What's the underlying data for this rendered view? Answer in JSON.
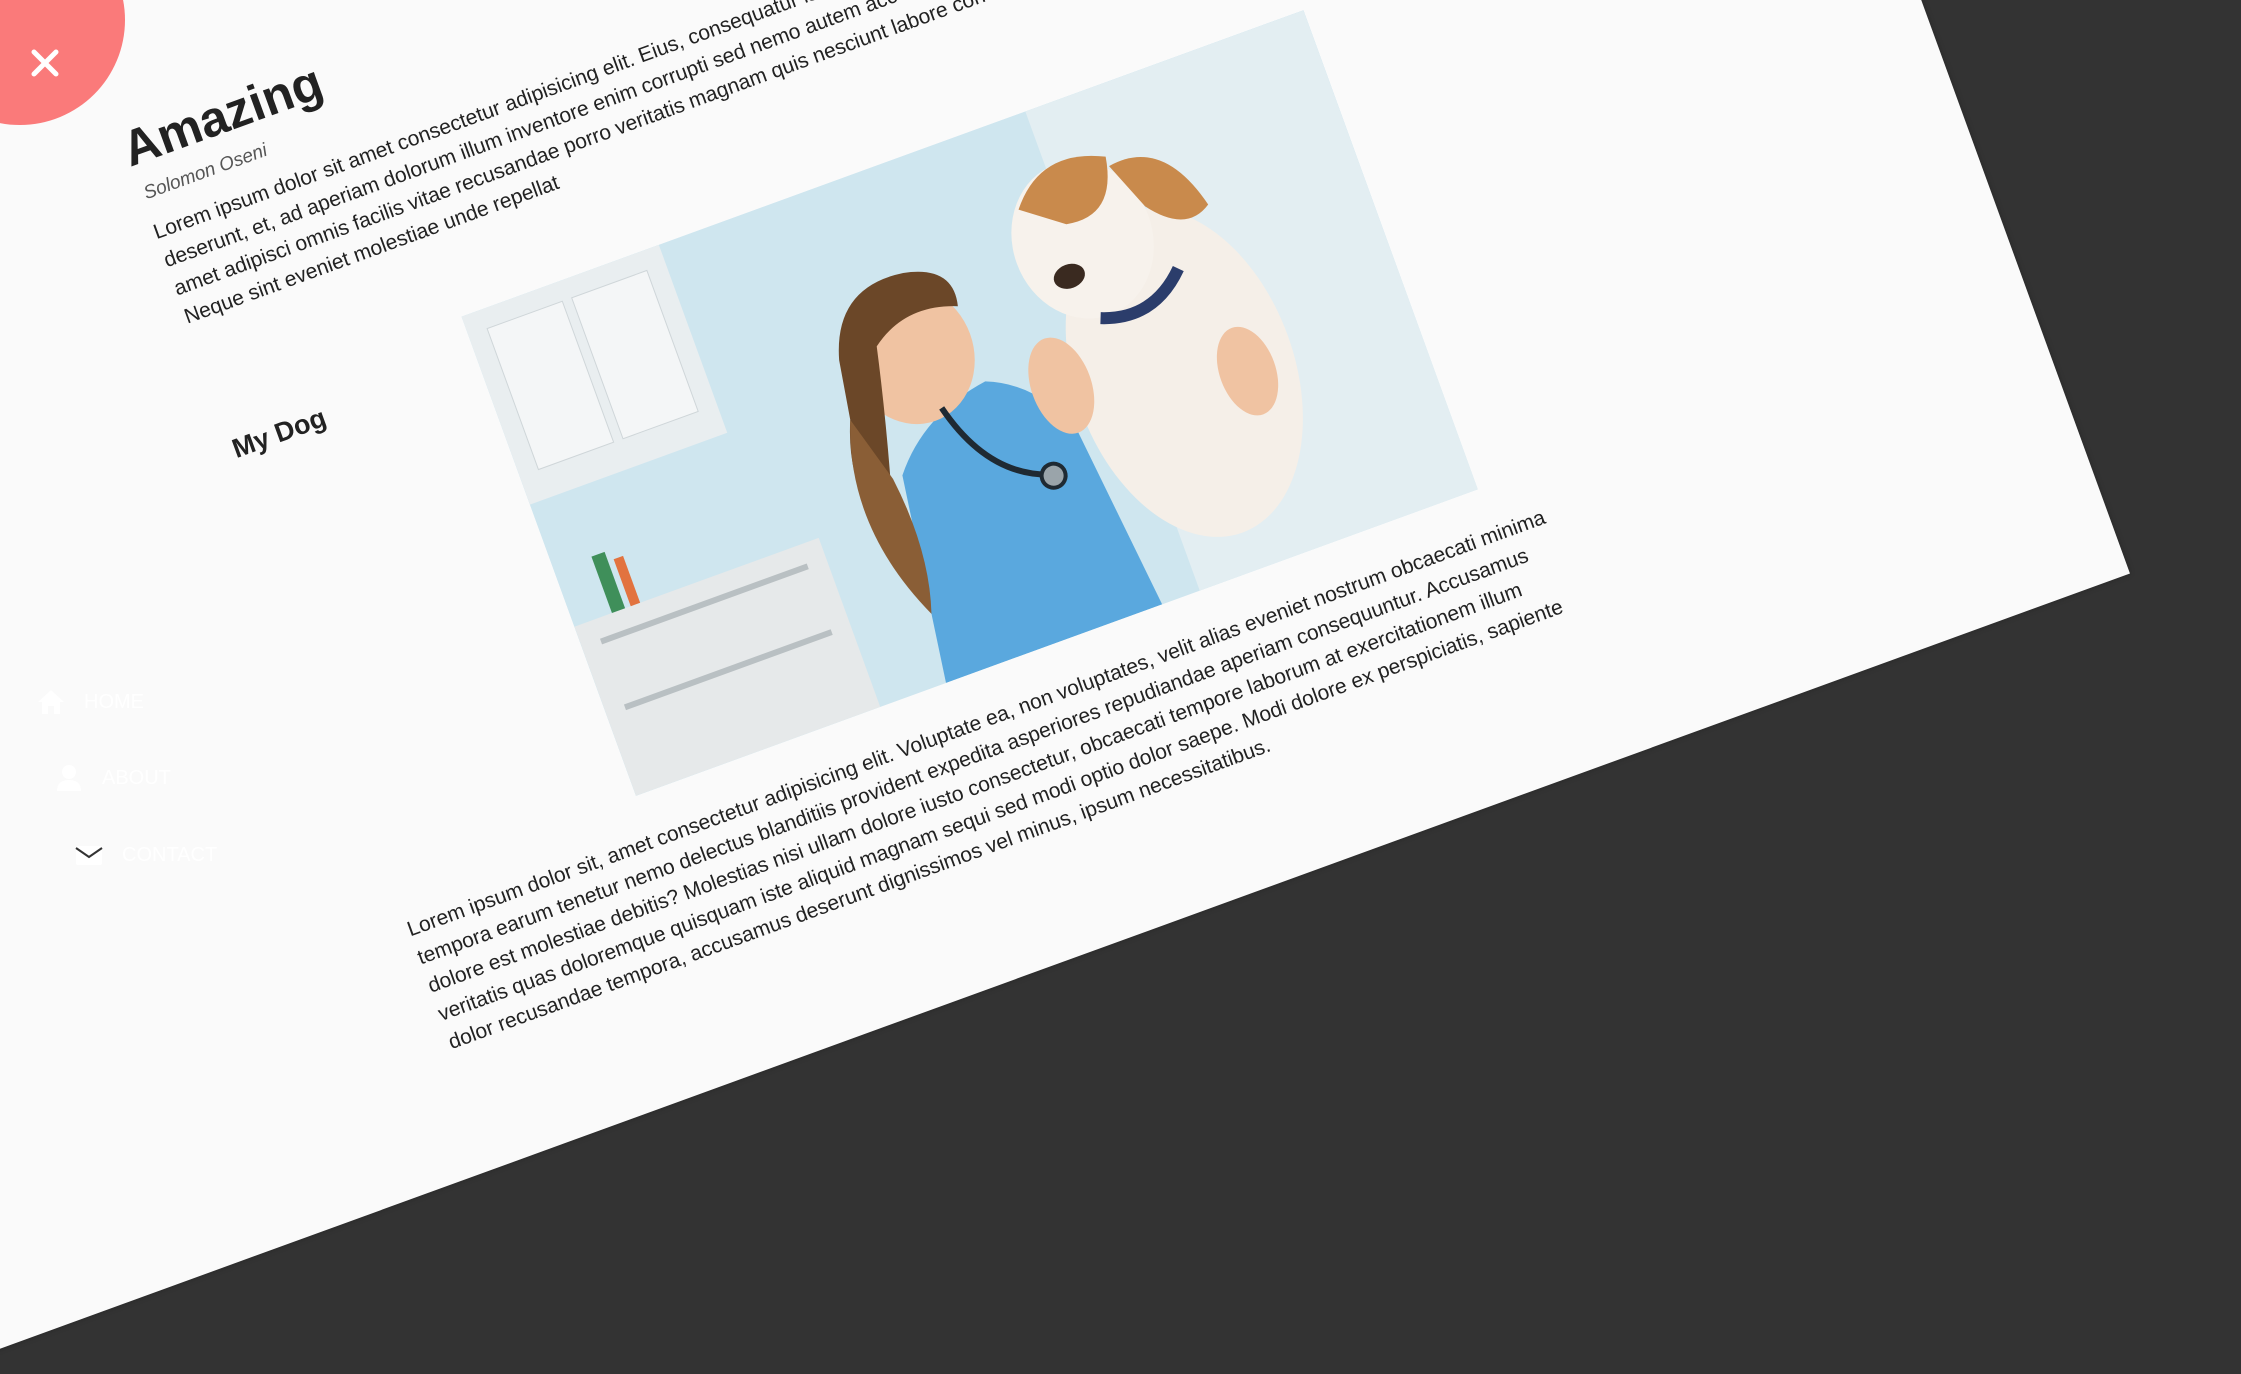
{
  "article": {
    "title": "Amazing",
    "author": "Solomon Oseni",
    "paragraph1": "Lorem ipsum dolor sit amet consectetur adipisicing elit. Eius, consequatur iste! Atque suscipit beatae vitae ad nisi, cupiditate deserunt, et, ad aperiam dolorum illum inventore enim corrupti sed nemo autem accusamus similique quidem explicabo sapiente amet adipisci omnis facilis vitae recusandae porro veritatis magnam quis nesciunt labore consectetur minus facere temporibus. Neque sint eveniet molestiae unde repellat",
    "subheading": "My Dog",
    "paragraph2": "Lorem ipsum dolor sit, amet consectetur adipisicing elit. Voluptate ea, non voluptates, velit alias eveniet nostrum obcaecati minima tempora earum tenetur nemo delectus blanditiis provident expedita asperiores repudiandae aperiam consequuntur. Accusamus dolore est molestiae debitis? Molestias nisi ullam dolore iusto consectetur, obcaecati tempore laborum at exercitationem illum veritatis quas doloremque quisquam iste aliquid magnam sequi sed modi optio dolor saepe. Modi dolore ex perspiciatis, sapiente dolor recusandae tempora, accusamus deserunt dignissimos vel minus, ipsum necessitatibus."
  },
  "nav": {
    "items": [
      {
        "label": "HOME",
        "icon": "home-icon"
      },
      {
        "label": "ABOUT",
        "icon": "user-icon"
      },
      {
        "label": "CONTACT",
        "icon": "envelope-icon"
      }
    ]
  },
  "close_button": {
    "icon": "close-icon",
    "color": "#fa7a7a"
  },
  "colors": {
    "background": "#333333",
    "page": "#fafafa",
    "accent": "#fa7a7a"
  }
}
